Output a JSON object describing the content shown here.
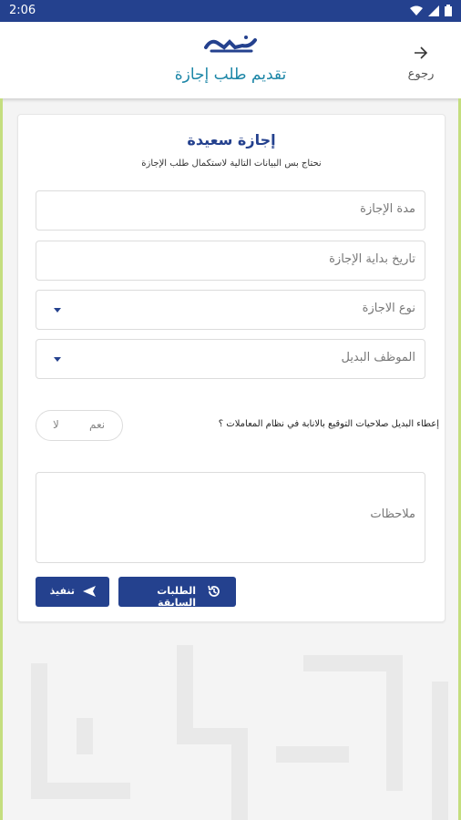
{
  "status_bar": {
    "time": "2:06"
  },
  "header": {
    "logo_text": "رقمي",
    "title": "تقديم طلب إجازة",
    "back_label": "رجوع"
  },
  "form": {
    "title": "إجازة سعيدة",
    "subtitle": "نحتاج بس البيانات التالية لاستكمال طلب الإجازة",
    "fields": {
      "duration": {
        "placeholder": "مدة الإجازة"
      },
      "start_date": {
        "placeholder": "تاريخ بداية الإجازة"
      },
      "leave_type": {
        "placeholder": "نوع الاجازة"
      },
      "substitute": {
        "placeholder": "الموظف البديل"
      }
    },
    "question": "إعطاء البديل صلاحيات التوقيع بالانابة في نظام المعاملات ؟",
    "toggle": {
      "yes": "نعم",
      "no": "لا"
    },
    "notes": {
      "placeholder": "ملاحظات"
    },
    "buttons": {
      "previous_requests": "الطلبات السابقة",
      "submit": "تنفيذ"
    }
  },
  "icons": {
    "back": "arrow-right-icon",
    "history": "history-icon",
    "send": "send-icon",
    "dropdown": "caret-down-icon"
  },
  "colors": {
    "primary": "#24418e",
    "accent": "#1c86a7",
    "border_accent": "#c4de7f"
  }
}
